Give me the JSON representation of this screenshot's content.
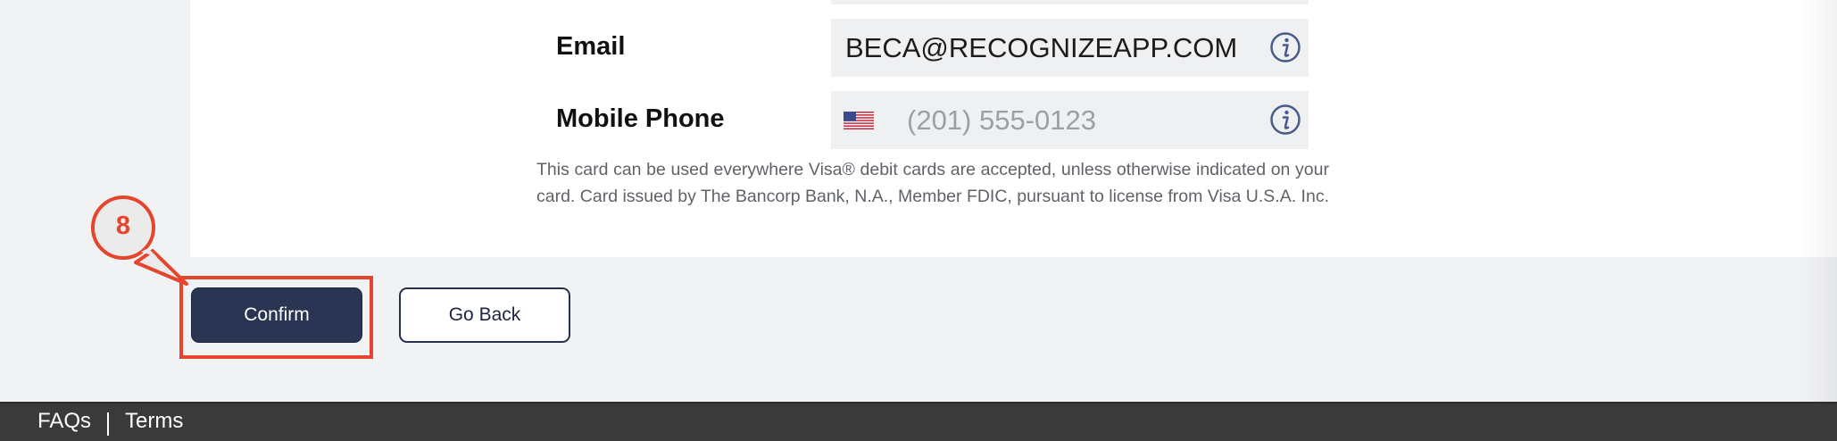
{
  "form": {
    "email": {
      "label": "Email",
      "value": "BECA@RECOGNIZEAPP.COM",
      "info_icon": "info-icon"
    },
    "mobile_phone": {
      "label": "Mobile Phone",
      "country_flag_icon": "us-flag-icon",
      "placeholder": "(201) 555-0123",
      "info_icon": "info-icon"
    }
  },
  "disclaimer": "This card can be used everywhere Visa® debit cards are accepted, unless otherwise indicated on your card. Card issued by The Bancorp Bank, N.A., Member FDIC, pursuant to license from Visa U.S.A. Inc.",
  "actions": {
    "confirm_label": "Confirm",
    "go_back_label": "Go Back"
  },
  "annotation": {
    "step_number": "8",
    "color": "#e5452d"
  },
  "footer": {
    "links": [
      "FAQs",
      "Terms"
    ]
  },
  "colors": {
    "primary_button": "#2a3553",
    "footer_bg": "#3a3a3a",
    "info_icon": "#4a5a8a"
  }
}
